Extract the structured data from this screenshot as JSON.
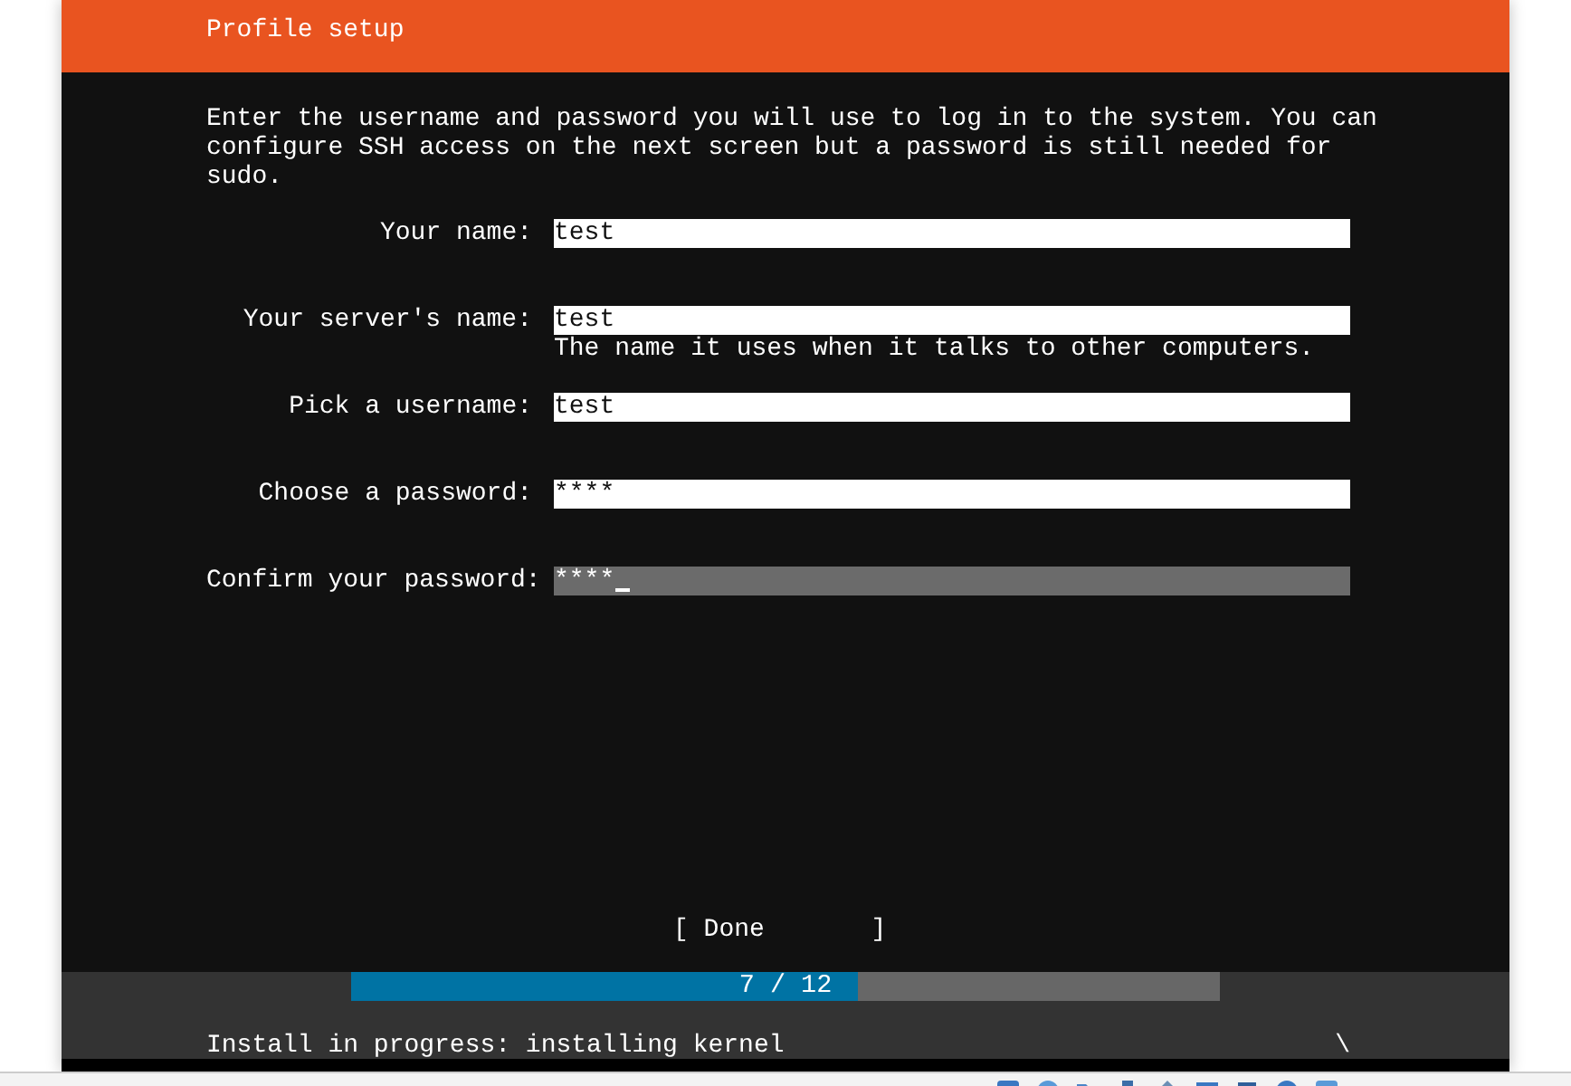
{
  "header": {
    "title": "Profile setup"
  },
  "intro": "Enter the username and password you will use to log in to the system. You can configure SSH access on the next screen but a password is still needed for sudo.",
  "fields": [
    {
      "label": "Your name:",
      "value": "test",
      "focused": false
    },
    {
      "label": "Your server's name:",
      "value": "test",
      "focused": false,
      "hint": "The name it uses when it talks to other computers."
    },
    {
      "label": "Pick a username:",
      "value": "test",
      "focused": false
    },
    {
      "label": "Choose a password:",
      "value": "****",
      "focused": false
    },
    {
      "label": "Confirm your password:",
      "value": "****",
      "focused": true
    }
  ],
  "done_button": {
    "open": "[ Done",
    "close": "]"
  },
  "progress": {
    "level": 0.5833,
    "label": "7 / 12"
  },
  "status": {
    "text": "Install in progress: installing kernel",
    "spinner": "\\"
  }
}
